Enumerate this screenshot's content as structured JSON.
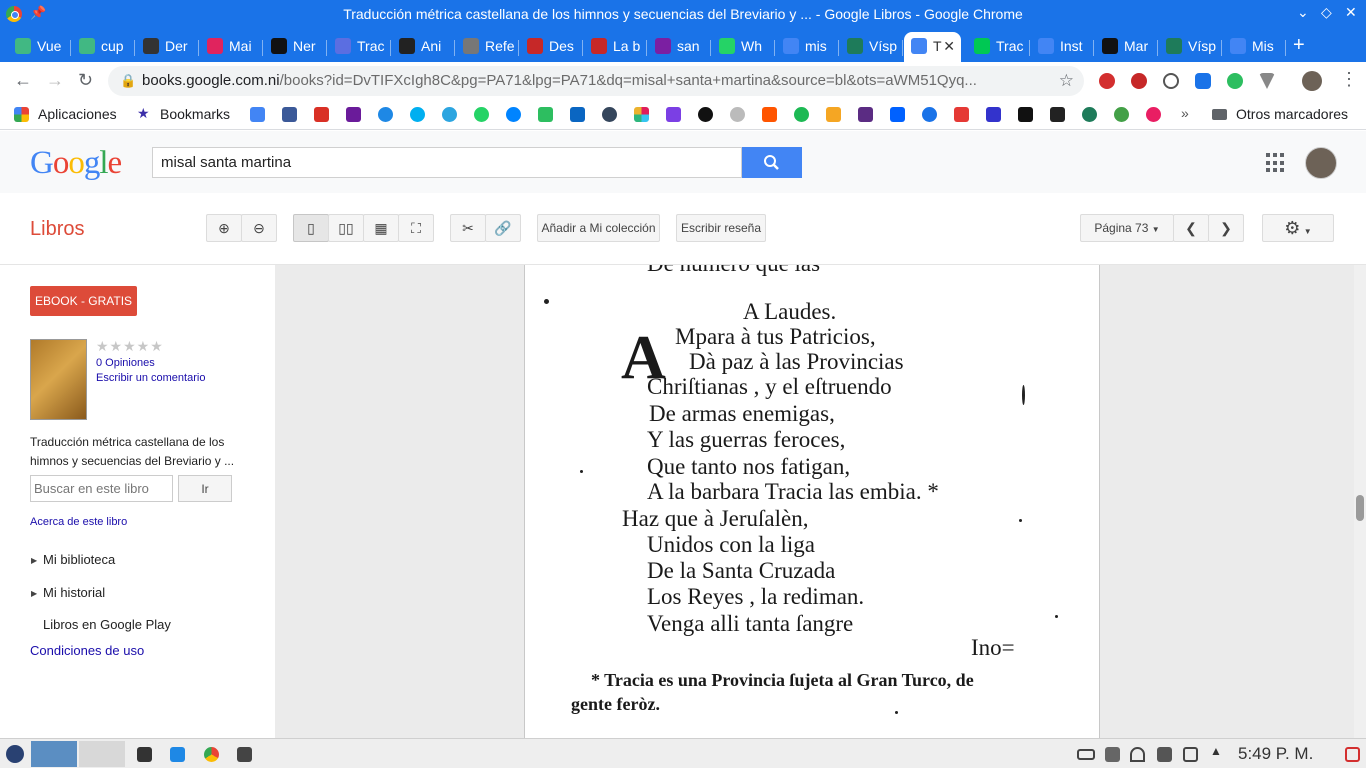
{
  "window": {
    "title": "Traducción métrica castellana de los himnos y secuencias del Breviario y ... - Google Libros - Google Chrome"
  },
  "tabs": [
    {
      "label": "Vue",
      "icon": "vue-icon",
      "color": "#41b883"
    },
    {
      "label": "cup",
      "icon": "vue-icon",
      "color": "#41b883"
    },
    {
      "label": "Der",
      "icon": "mail-icon",
      "color": "#333"
    },
    {
      "label": "Mai",
      "icon": "mail-icon",
      "color": "#e0245e"
    },
    {
      "label": "Ner",
      "icon": "github-icon",
      "color": "#111"
    },
    {
      "label": "Trac",
      "icon": "translate-icon",
      "color": "#5b6ee1"
    },
    {
      "label": "Ani",
      "icon": "af-icon",
      "color": "#222"
    },
    {
      "label": "Refe",
      "icon": "globe-icon",
      "color": "#777"
    },
    {
      "label": "Des",
      "icon": "bookmark-icon",
      "color": "#c62828"
    },
    {
      "label": "La b",
      "icon": "bookmark-icon",
      "color": "#c62828"
    },
    {
      "label": "san",
      "icon": "mail-icon",
      "color": "#7b1fa2"
    },
    {
      "label": "Wh",
      "icon": "whatsapp-icon",
      "color": "#25d366"
    },
    {
      "label": "mis",
      "icon": "google-icon",
      "color": "#4285f4"
    },
    {
      "label": "Vísp",
      "icon": "globe-icon",
      "color": "#1e7b5a"
    },
    {
      "label": "T",
      "icon": "google-icon",
      "color": "#4285f4",
      "active": true
    },
    {
      "label": "Trac",
      "icon": "play-icon",
      "color": "#00c853"
    },
    {
      "label": "Inst",
      "icon": "google-icon",
      "color": "#4285f4"
    },
    {
      "label": "Mar",
      "icon": "wikipedia-icon",
      "color": "#111"
    },
    {
      "label": "Vísp",
      "icon": "globe-icon",
      "color": "#1e7b5a"
    },
    {
      "label": "Mis",
      "icon": "google-icon",
      "color": "#4285f4"
    }
  ],
  "address": {
    "host": "books.google.com.ni",
    "path": "/books?id=DvTIFXcIgh8C&pg=PA71&lpg=PA71&dq=misal+santa+martina&source=bl&ots=aWM51Qyq..."
  },
  "bookmarks": {
    "apps_label": "Aplicaciones",
    "bookmarks_label": "Bookmarks",
    "more": "»",
    "other_label": "Otros marcadores"
  },
  "google": {
    "logo": "Google",
    "query": "misal santa martina"
  },
  "books": {
    "section": "Libros",
    "add_collection": "Añadir a Mi colección",
    "write_review": "Escribir reseña",
    "page_select": "Página 73",
    "ebook": "EBOOK - GRATIS",
    "stars": "★★★★★",
    "rating": 0,
    "opinions": "0 Opiniones",
    "write_comment": "Escribir un comentario",
    "title": "Traducción métrica castellana de los himnos y secuencias del Breviario y ...",
    "search_placeholder": "Buscar en este libro",
    "go": "Ir",
    "about": "Acerca de este libro",
    "my_library": "Mi biblioteca",
    "my_history": "Mi historial",
    "play_books": "Libros en Google Play",
    "terms": "Condiciones de uso"
  },
  "page_text": {
    "top_cut": "De numero que las",
    "heading": "A Laudes.",
    "dropcap": "A",
    "lines": [
      "Mpara à tus Patricios,",
      "Dà paz à las Provincias",
      "Chriſtianas , y el eſtruendo",
      "De armas enemigas,",
      "Y las guerras feroces,",
      "Que tanto nos fatigan,",
      "A la barbara Tracia las embia. *",
      "Haz que  à  Jeruſalèn,",
      "Unidos con la liga",
      "De la Santa Cruzada",
      "Los Reyes , la rediman.",
      "Venga alli tanta ſangre"
    ],
    "catchword": "Ino=",
    "footnote_1": "* Tracia es una Provincia ſujeta al Gran Turco, de",
    "footnote_2": "gente feròz."
  },
  "taskbar": {
    "clock": "5:49 P. M."
  }
}
